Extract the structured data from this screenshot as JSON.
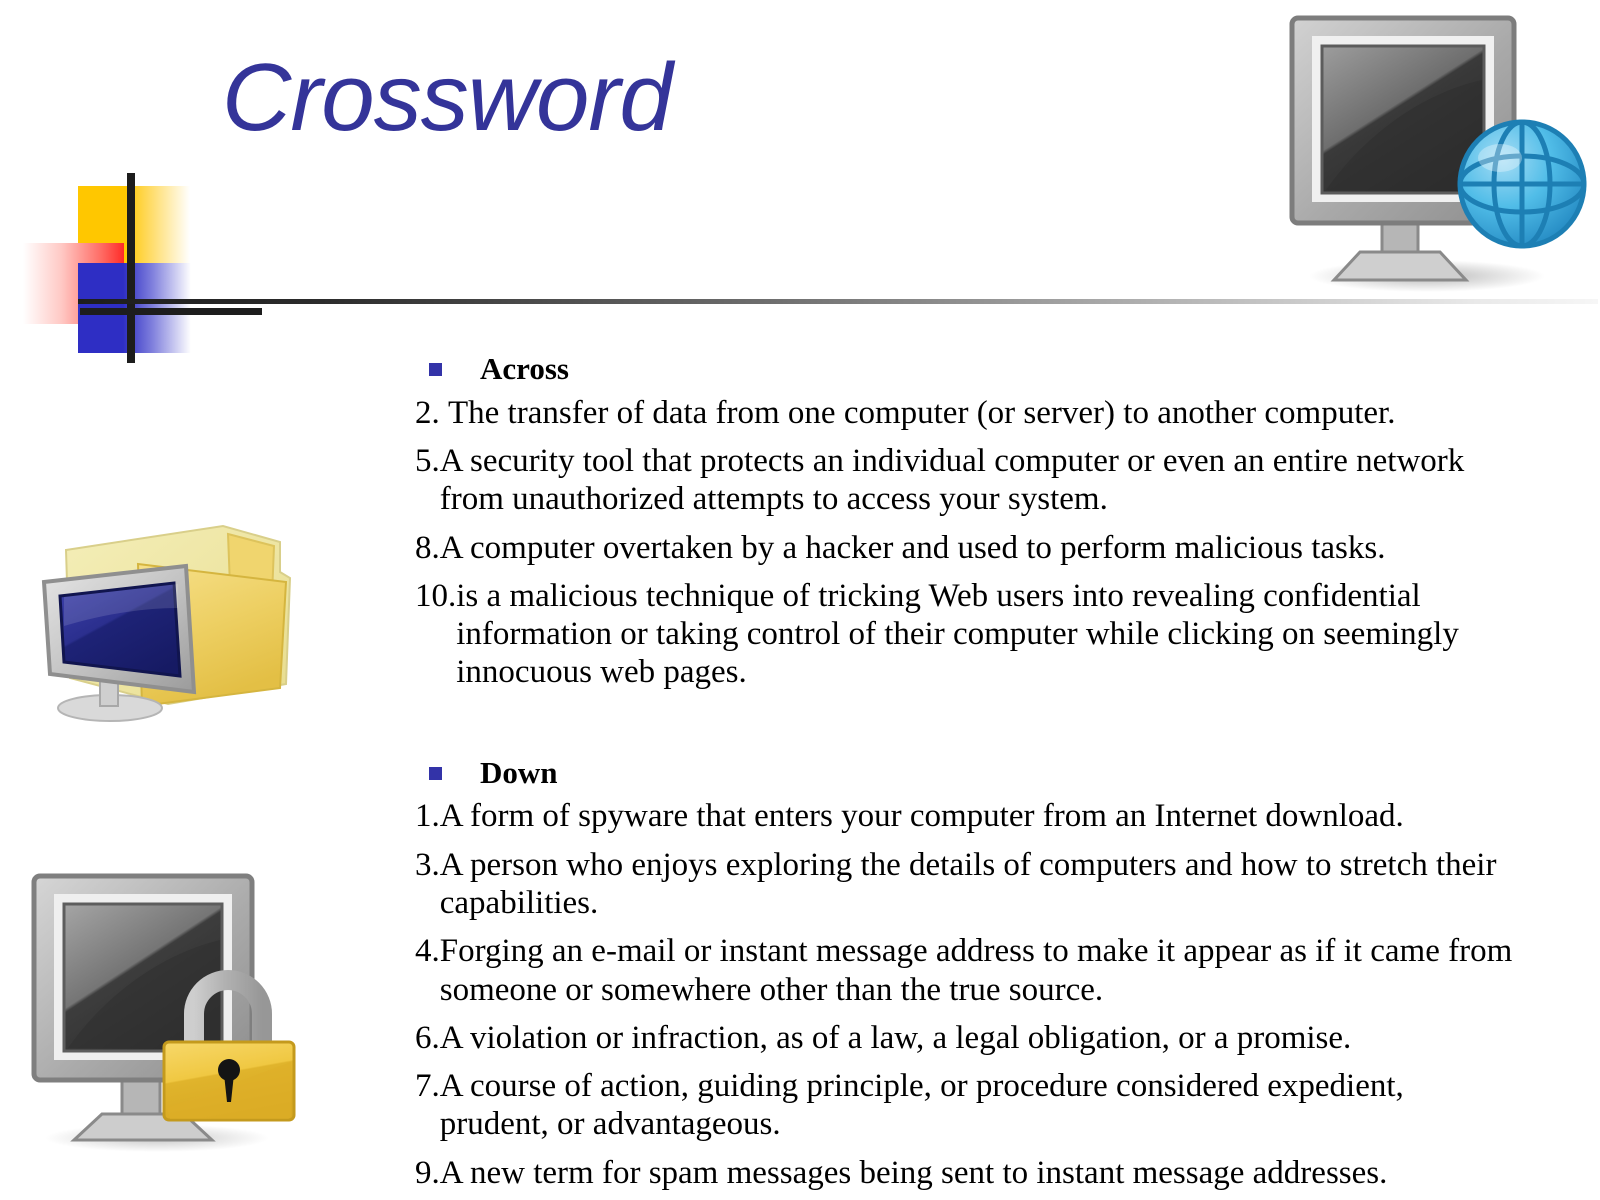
{
  "slide": {
    "title": "Crossword",
    "title_color": "#343499",
    "bullet_color": "#3333a8",
    "background": "#ffffff"
  },
  "sections": [
    {
      "heading": "Across",
      "clues": [
        {
          "num": "2. ",
          "text": "The transfer of data from one computer (or server) to another computer."
        },
        {
          "num": "5.",
          "text": "A security tool that protects an individual computer or even an entire network from unauthorized attempts to access your system."
        },
        {
          "num": "8.",
          "text": "A computer overtaken by a hacker and used to perform malicious tasks."
        },
        {
          "num": "10.",
          "text": "is a malicious technique of tricking Web users into revealing confidential information or taking control of their computer while clicking on seemingly innocuous web pages."
        }
      ]
    },
    {
      "heading": "Down",
      "clues": [
        {
          "num": "1.",
          "text": "A form of spyware that enters your computer from an Internet download."
        },
        {
          "num": "3.",
          "text": "A person who enjoys exploring the details of computers and how to stretch their capabilities."
        },
        {
          "num": "4.",
          "text": "Forging an e-mail or instant message address to make it appear as if it came from someone or somewhere other than the true source."
        },
        {
          "num": "6.",
          "text": "A violation or infraction, as of a law, a legal obligation, or a promise."
        },
        {
          "num": "7.",
          "text": "A course of action, guiding principle, or procedure considered expedient, prudent, or advantageous."
        },
        {
          "num": "9.",
          "text": "A new term for spam messages being sent to instant message addresses."
        }
      ]
    }
  ],
  "graphics": {
    "network_monitor": "monitor-globe-icon",
    "folder_monitor": "monitor-folder-icon",
    "lock_monitor": "monitor-padlock-icon",
    "template_logo": "colored-squares-logo",
    "divider": "fading-horizontal-rule"
  }
}
